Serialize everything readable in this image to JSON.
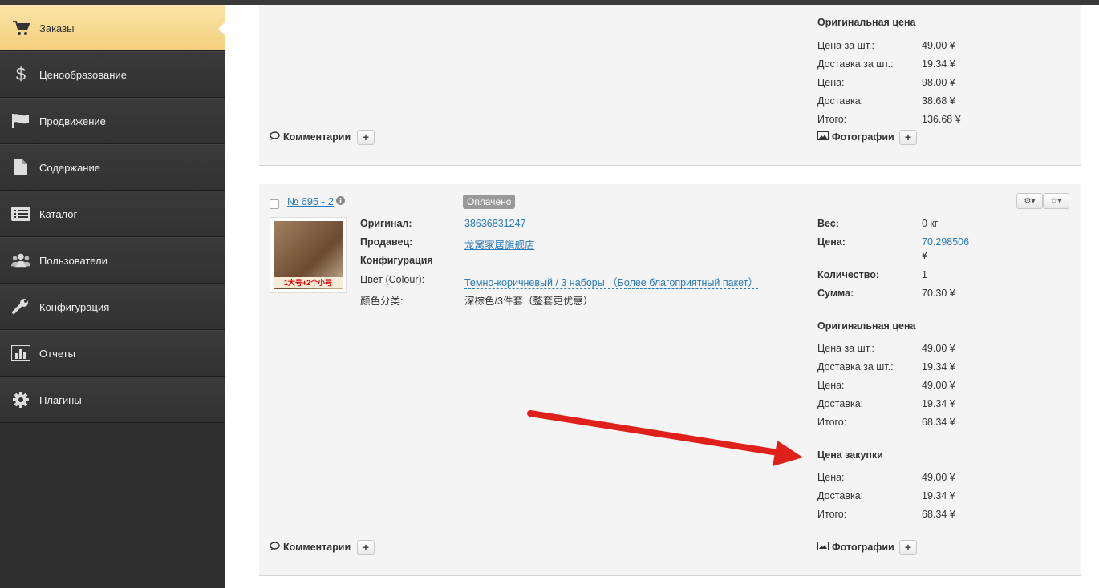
{
  "sidebar": {
    "items": [
      {
        "label": "Заказы",
        "icon": "cart-icon"
      },
      {
        "label": "Ценообразование",
        "icon": "dollar-icon"
      },
      {
        "label": "Продвижение",
        "icon": "flag-icon"
      },
      {
        "label": "Содержание",
        "icon": "document-icon"
      },
      {
        "label": "Каталог",
        "icon": "list-icon"
      },
      {
        "label": "Пользователи",
        "icon": "users-icon"
      },
      {
        "label": "Конфигурация",
        "icon": "wrench-icon"
      },
      {
        "label": "Отчеты",
        "icon": "chart-icon"
      },
      {
        "label": "Плагины",
        "icon": "gear-icon"
      }
    ]
  },
  "card1": {
    "original_price_title": "Оригинальная цена",
    "rows": [
      {
        "label": "Цена за шт.:",
        "value": "49.00 ¥"
      },
      {
        "label": "Доставка за шт.:",
        "value": "19.34 ¥"
      },
      {
        "label": "Цена:",
        "value": "98.00 ¥"
      },
      {
        "label": "Доставка:",
        "value": "38.68 ¥"
      },
      {
        "label": "Итого:",
        "value": "136.68 ¥"
      }
    ],
    "comments": "Комментарии",
    "photos": "Фотографии"
  },
  "card2": {
    "order_number": "№ 695 - 2",
    "status": "Оплачено",
    "thumb_text": "1大号+2个小号",
    "original_label": "Оригинал:",
    "original_value": "38636831247",
    "seller_label": "Продавец:",
    "seller_value": "龙窝家居旗舰店",
    "config_label": "Конфигурация",
    "color_label": "Цвет (Colour):",
    "color_value": "Темно-коричневый / 3 наборы （Более благоприятный пакет）",
    "cn_label": "颜色分类:",
    "cn_value": "深棕色/3件套（整套更优惠）",
    "weight_label": "Вес:",
    "weight_value": "0 кг",
    "price_label": "Цена:",
    "price_value": "70.298506",
    "price_currency": "¥",
    "qty_label": "Количество:",
    "qty_value": "1",
    "sum_label": "Сумма:",
    "sum_value": "70.30 ¥",
    "original_price_title": "Оригинальная цена",
    "orig_rows": [
      {
        "label": "Цена за шт.:",
        "value": "49.00 ¥"
      },
      {
        "label": "Доставка за шт.:",
        "value": "19.34 ¥"
      },
      {
        "label": "Цена:",
        "value": "49.00 ¥"
      },
      {
        "label": "Доставка:",
        "value": "19.34 ¥"
      },
      {
        "label": "Итого:",
        "value": "68.34 ¥"
      }
    ],
    "purchase_title": "Цена закупки",
    "purchase_rows": [
      {
        "label": "Цена:",
        "value": "49.00 ¥"
      },
      {
        "label": "Доставка:",
        "value": "19.34 ¥"
      },
      {
        "label": "Итого:",
        "value": "68.34 ¥"
      }
    ],
    "comments": "Комментарии",
    "photos": "Фотографии"
  },
  "colors": {
    "sidebar": "#2f2f2f",
    "active": "#f3cf7c",
    "link": "#2a7ab9",
    "arrow": "#e0201a"
  }
}
